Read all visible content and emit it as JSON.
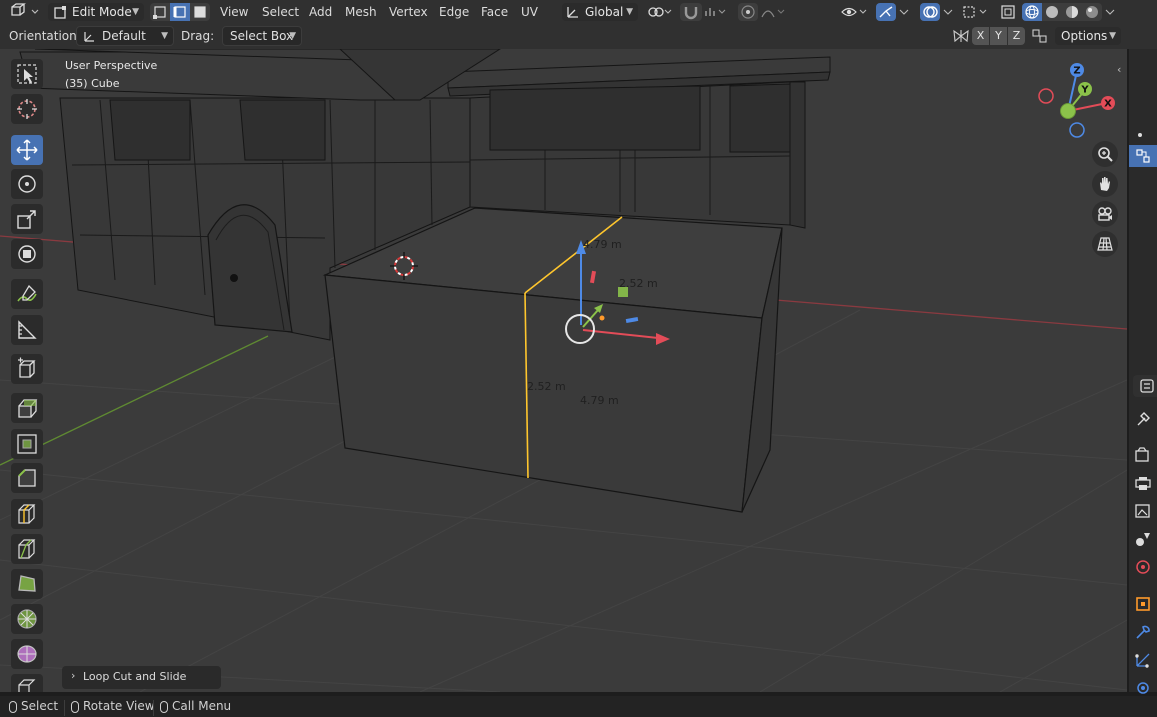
{
  "header": {
    "mode": "Edit Mode",
    "menus": [
      "View",
      "Select",
      "Add",
      "Mesh",
      "Vertex",
      "Edge",
      "Face",
      "UV"
    ],
    "transform_orientation": "Global",
    "editor_type_icon": "mesh-editor-icon",
    "select_mode_icons": [
      "vertex-select-icon",
      "edge-select-icon",
      "face-select-icon"
    ]
  },
  "tool_settings": {
    "orientation_label": "Orientation:",
    "orientation_value": "Default",
    "drag_label": "Drag:",
    "drag_value": "Select Box",
    "axes": [
      "X",
      "Y",
      "Z"
    ],
    "options_label": "Options"
  },
  "viewport": {
    "view_name": "User Perspective",
    "object_info": "(35) Cube",
    "measurements": {
      "top_depth": "4.79 m",
      "top_width": "2.52 m",
      "front_height": "2.52 m",
      "front_width": "4.79 m"
    },
    "gizmo_axes": [
      "Z",
      "Y",
      "X"
    ]
  },
  "toolbar": {
    "items": [
      "select-box-icon",
      "cursor-icon",
      "move-icon",
      "rotate-icon",
      "scale-icon",
      "transform-icon",
      "annotate-icon",
      "measure-icon",
      "add-cube-icon",
      "extrude-icon",
      "inset-icon",
      "bevel-icon",
      "loop-cut-icon",
      "knife-icon",
      "poly-build-icon",
      "spin-icon",
      "smooth-icon",
      "edge-slide-icon"
    ],
    "active": "move-icon"
  },
  "last_operator": "Loop Cut and Slide",
  "status_bar": {
    "items": [
      "Select",
      "Rotate View",
      "Call Menu"
    ]
  },
  "colors": {
    "active_tool": "#4772b3",
    "x_axis": "#e34c58",
    "y_axis": "#8bc24a",
    "z_axis": "#4e8ae6",
    "selected_edge": "#ffc62d"
  }
}
